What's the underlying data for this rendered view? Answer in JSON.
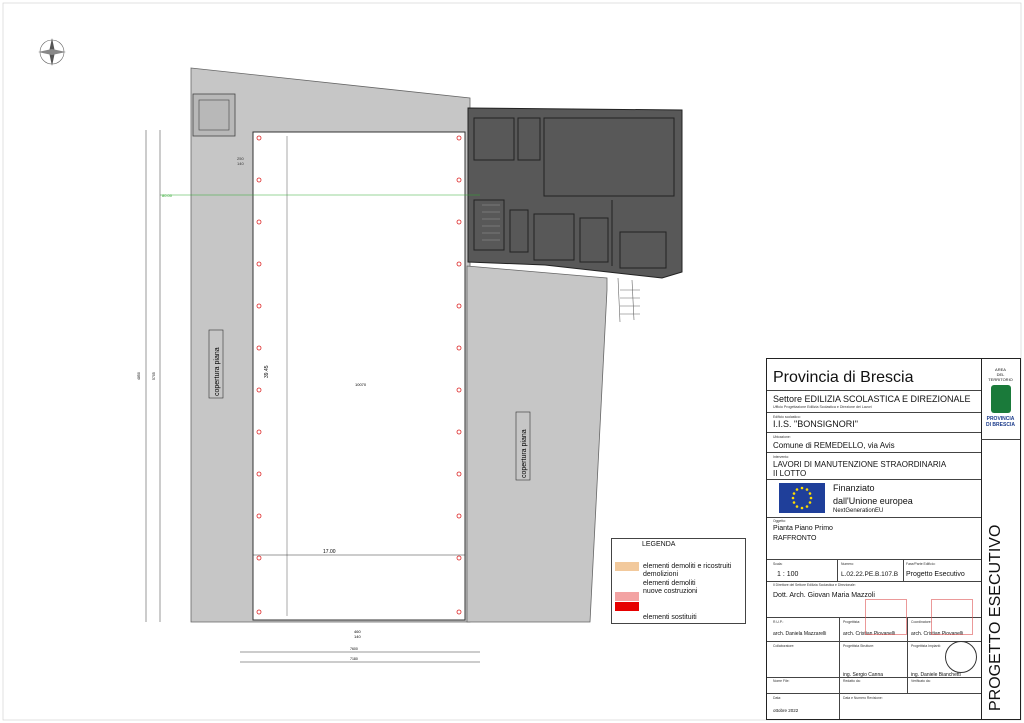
{
  "plan": {
    "label_left": "copertura piana",
    "label_right": "copertura piana",
    "dim_width": "17.00",
    "dim_height": "39.45",
    "center_label": "10070",
    "axis_label": "80.00",
    "bay_top": "250",
    "bay_bottom": "140",
    "gap_label": "460",
    "gap_sub": "140",
    "total_a": "7600",
    "total_b": "7180",
    "side_a": "4850",
    "side_b": "5705"
  },
  "legend": {
    "title": "LEGENDA",
    "items": [
      {
        "text": "elementi demoliti e ricostruiti",
        "text2": "demolizioni",
        "color": "#f2c99c"
      },
      {
        "text": "elementi demoliti",
        "text2": "nuove costruzioni",
        "color": "#f3a3a3"
      },
      {
        "text": "elementi sostituiti",
        "color": "#e60000"
      }
    ]
  },
  "titleblock": {
    "org": "Provincia di Brescia",
    "sector": "Settore EDILIZIA SCOLASTICA E DIREZIONALE",
    "office": "Ufficio Progettazione Edilizia Scolastica e Direzione dei Lavori",
    "school_label": "Edificio scolastico:",
    "school": "I.I.S. \"BONSIGNORI\"",
    "location_label": "Ubicazione:",
    "location": "Comune di REMEDELLO, via Avis",
    "work_label": "Intervento:",
    "work_1": "LAVORI DI MANUTENZIONE STRAORDINARIA",
    "work_2": "II LOTTO",
    "eu_1": "Finanziato",
    "eu_2": "dall'Unione europea",
    "eu_3": "NextGenerationEU",
    "subject_label": "Oggetto:",
    "subject_1": "Pianta Piano Primo",
    "subject_2": "RAFFRONTO",
    "scale_label": "Scala:",
    "scale": "1 : 100",
    "number_label": "Numero:",
    "number": "L.02.22.PE.B.107.B",
    "phase_label": "Fase/Parte Edificio:",
    "phase": "Progetto Esecutivo",
    "director_label": "Il Direttore del Settore Edilizia Scolastica e Direzionale:",
    "director": "Dott. Arch. Giovan Maria Mazzoli",
    "rup_label": "R.U.P.:",
    "rup": "arch. Daniela Mazzarelli",
    "designer_label": "Progettista:",
    "designer": "arch. Cristian Piovanelli",
    "coord_label": "Coordinatore:",
    "coord": "arch. Cristian Piovanelli",
    "collab_label": "Collaboratore:",
    "struct_label": "Progettista Strutture:",
    "struct": "ing. Sergio Canna",
    "plant_label": "Progettista Impianti:",
    "plant": "ing. Daniele Bianchetti",
    "file_label": "Nome File:",
    "date_label": "Data:",
    "date": "ottobre 2022",
    "revised_label": "Data e Numero Revisione:",
    "checked_label": "Verificato da:",
    "drawn_label": "Redatto da:",
    "area_1": "AREA",
    "area_2": "DEL",
    "area_3": "TERRITORIO",
    "prov_1": "PROVINCIA",
    "prov_2": "DI BRESCIA",
    "vertical": "PROGETTO ESECUTIVO"
  }
}
